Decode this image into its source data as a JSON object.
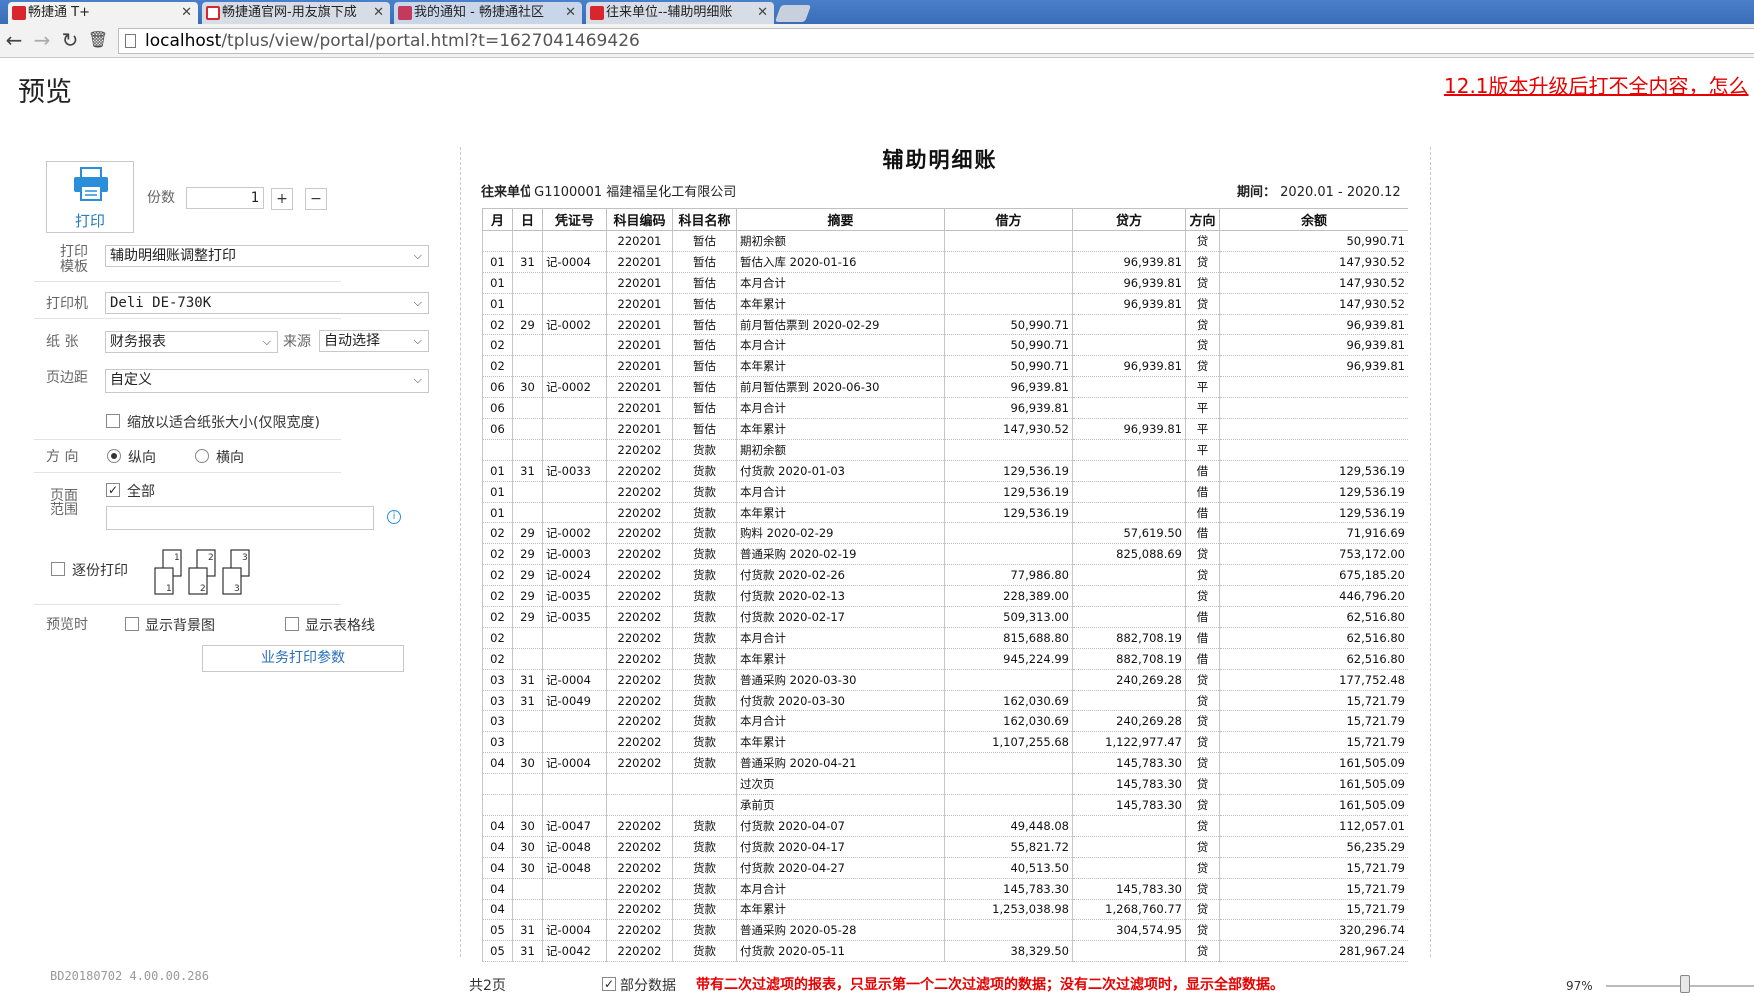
{
  "browser": {
    "tabs": [
      {
        "label": "畅捷通 T+",
        "color": "#d8262c"
      },
      {
        "label": "畅捷通官网-用友旗下成",
        "color": "#d8262c"
      },
      {
        "label": "我的通知 - 畅捷通社区",
        "color": "#c43a5e"
      },
      {
        "label": "往来单位--辅助明细账",
        "color": "#d8262c"
      }
    ],
    "url_host": "localhost",
    "url_path": "/tplus/view/portal/portal.html?t=1627041469426"
  },
  "page": {
    "title": "预览",
    "notice_link": "12.1版本升级后打不全内容，怎么"
  },
  "print_panel": {
    "print_label": "打印",
    "copies_label": "份数",
    "copies_value": "1",
    "plus": "+",
    "minus": "−",
    "template_label_1": "打印",
    "template_label_2": "模板",
    "template_value": "辅助明细账调整打印",
    "printer_label": "打印机",
    "printer_value": "Deli DE-730K",
    "paper_label": "纸 张",
    "paper_value": "财务报表",
    "source_label": "来源",
    "source_value": "自动选择",
    "margin_label": "页边距",
    "margin_value": "自定义",
    "scale_fit_label": "缩放以适合纸张大小(仅限宽度)",
    "orientation_label": "方 向",
    "portrait_label": "纵向",
    "landscape_label": "横向",
    "range_label_1": "页面",
    "range_label_2": "范围",
    "all_label": "全部",
    "collate_label": "逐份打印",
    "preview_label": "预览时",
    "show_bg_label": "显示背景图",
    "show_grid_label": "显示表格线",
    "business_params": "业务打印参数",
    "version": "BD20180702 4.00.00.286"
  },
  "report": {
    "title": "辅助明细账",
    "partner_label": "往来单位:",
    "partner_value": "G1100001 福建福呈化工有限公司",
    "period_label": "期间：",
    "period_value": "2020.01 - 2020.12",
    "columns": [
      "月",
      "日",
      "凭证号",
      "科目编码",
      "科目名称",
      "摘要",
      "借方",
      "贷方",
      "方向",
      "余额"
    ],
    "rows": [
      [
        "",
        "",
        "",
        "220201",
        "暂估",
        "期初余额",
        "",
        "",
        "贷",
        "50,990.71"
      ],
      [
        "01",
        "31",
        "记-0004",
        "220201",
        "暂估",
        "暂估入库 2020-01-16",
        "",
        "96,939.81",
        "贷",
        "147,930.52"
      ],
      [
        "01",
        "",
        "",
        "220201",
        "暂估",
        "本月合计",
        "",
        "96,939.81",
        "贷",
        "147,930.52"
      ],
      [
        "01",
        "",
        "",
        "220201",
        "暂估",
        "本年累计",
        "",
        "96,939.81",
        "贷",
        "147,930.52"
      ],
      [
        "02",
        "29",
        "记-0002",
        "220201",
        "暂估",
        "前月暂估票到 2020-02-29",
        "50,990.71",
        "",
        "贷",
        "96,939.81"
      ],
      [
        "02",
        "",
        "",
        "220201",
        "暂估",
        "本月合计",
        "50,990.71",
        "",
        "贷",
        "96,939.81"
      ],
      [
        "02",
        "",
        "",
        "220201",
        "暂估",
        "本年累计",
        "50,990.71",
        "96,939.81",
        "贷",
        "96,939.81"
      ],
      [
        "06",
        "30",
        "记-0002",
        "220201",
        "暂估",
        "前月暂估票到 2020-06-30",
        "96,939.81",
        "",
        "平",
        ""
      ],
      [
        "06",
        "",
        "",
        "220201",
        "暂估",
        "本月合计",
        "96,939.81",
        "",
        "平",
        ""
      ],
      [
        "06",
        "",
        "",
        "220201",
        "暂估",
        "本年累计",
        "147,930.52",
        "96,939.81",
        "平",
        ""
      ],
      [
        "",
        "",
        "",
        "220202",
        "货款",
        "期初余额",
        "",
        "",
        "平",
        ""
      ],
      [
        "01",
        "31",
        "记-0033",
        "220202",
        "货款",
        "付货款 2020-01-03",
        "129,536.19",
        "",
        "借",
        "129,536.19"
      ],
      [
        "01",
        "",
        "",
        "220202",
        "货款",
        "本月合计",
        "129,536.19",
        "",
        "借",
        "129,536.19"
      ],
      [
        "01",
        "",
        "",
        "220202",
        "货款",
        "本年累计",
        "129,536.19",
        "",
        "借",
        "129,536.19"
      ],
      [
        "02",
        "29",
        "记-0002",
        "220202",
        "货款",
        "购料 2020-02-29",
        "",
        "57,619.50",
        "借",
        "71,916.69"
      ],
      [
        "02",
        "29",
        "记-0003",
        "220202",
        "货款",
        "普通采购 2020-02-19",
        "",
        "825,088.69",
        "贷",
        "753,172.00"
      ],
      [
        "02",
        "29",
        "记-0024",
        "220202",
        "货款",
        "付货款 2020-02-26",
        "77,986.80",
        "",
        "贷",
        "675,185.20"
      ],
      [
        "02",
        "29",
        "记-0035",
        "220202",
        "货款",
        "付货款 2020-02-13",
        "228,389.00",
        "",
        "贷",
        "446,796.20"
      ],
      [
        "02",
        "29",
        "记-0035",
        "220202",
        "货款",
        "付货款 2020-02-17",
        "509,313.00",
        "",
        "借",
        "62,516.80"
      ],
      [
        "02",
        "",
        "",
        "220202",
        "货款",
        "本月合计",
        "815,688.80",
        "882,708.19",
        "借",
        "62,516.80"
      ],
      [
        "02",
        "",
        "",
        "220202",
        "货款",
        "本年累计",
        "945,224.99",
        "882,708.19",
        "借",
        "62,516.80"
      ],
      [
        "03",
        "31",
        "记-0004",
        "220202",
        "货款",
        "普通采购 2020-03-30",
        "",
        "240,269.28",
        "贷",
        "177,752.48"
      ],
      [
        "03",
        "31",
        "记-0049",
        "220202",
        "货款",
        "付货款 2020-03-30",
        "162,030.69",
        "",
        "贷",
        "15,721.79"
      ],
      [
        "03",
        "",
        "",
        "220202",
        "货款",
        "本月合计",
        "162,030.69",
        "240,269.28",
        "贷",
        "15,721.79"
      ],
      [
        "03",
        "",
        "",
        "220202",
        "货款",
        "本年累计",
        "1,107,255.68",
        "1,122,977.47",
        "贷",
        "15,721.79"
      ],
      [
        "04",
        "30",
        "记-0004",
        "220202",
        "货款",
        "普通采购 2020-04-21",
        "",
        "145,783.30",
        "贷",
        "161,505.09"
      ],
      [
        "",
        "",
        "",
        "",
        "",
        "过次页",
        "",
        "145,783.30",
        "贷",
        "161,505.09"
      ],
      [
        "",
        "",
        "",
        "",
        "",
        "承前页",
        "",
        "145,783.30",
        "贷",
        "161,505.09"
      ],
      [
        "04",
        "30",
        "记-0047",
        "220202",
        "货款",
        "付货款 2020-04-07",
        "49,448.08",
        "",
        "贷",
        "112,057.01"
      ],
      [
        "04",
        "30",
        "记-0048",
        "220202",
        "货款",
        "付货款 2020-04-17",
        "55,821.72",
        "",
        "贷",
        "56,235.29"
      ],
      [
        "04",
        "30",
        "记-0048",
        "220202",
        "货款",
        "付货款 2020-04-27",
        "40,513.50",
        "",
        "贷",
        "15,721.79"
      ],
      [
        "04",
        "",
        "",
        "220202",
        "货款",
        "本月合计",
        "145,783.30",
        "145,783.30",
        "贷",
        "15,721.79"
      ],
      [
        "04",
        "",
        "",
        "220202",
        "货款",
        "本年累计",
        "1,253,038.98",
        "1,268,760.77",
        "贷",
        "15,721.79"
      ],
      [
        "05",
        "31",
        "记-0004",
        "220202",
        "货款",
        "普通采购 2020-05-28",
        "",
        "304,574.95",
        "贷",
        "320,296.74"
      ],
      [
        "05",
        "31",
        "记-0042",
        "220202",
        "货款",
        "付货款 2020-05-11",
        "38,329.50",
        "",
        "贷",
        "281,967.24"
      ]
    ]
  },
  "status": {
    "pages": "共2页",
    "partial_label": "部分数据",
    "warning": "带有二次过滤项的报表，只显示第一个二次过滤项的数据；没有二次过滤项时，显示全部数据。",
    "zoom": "97%"
  }
}
